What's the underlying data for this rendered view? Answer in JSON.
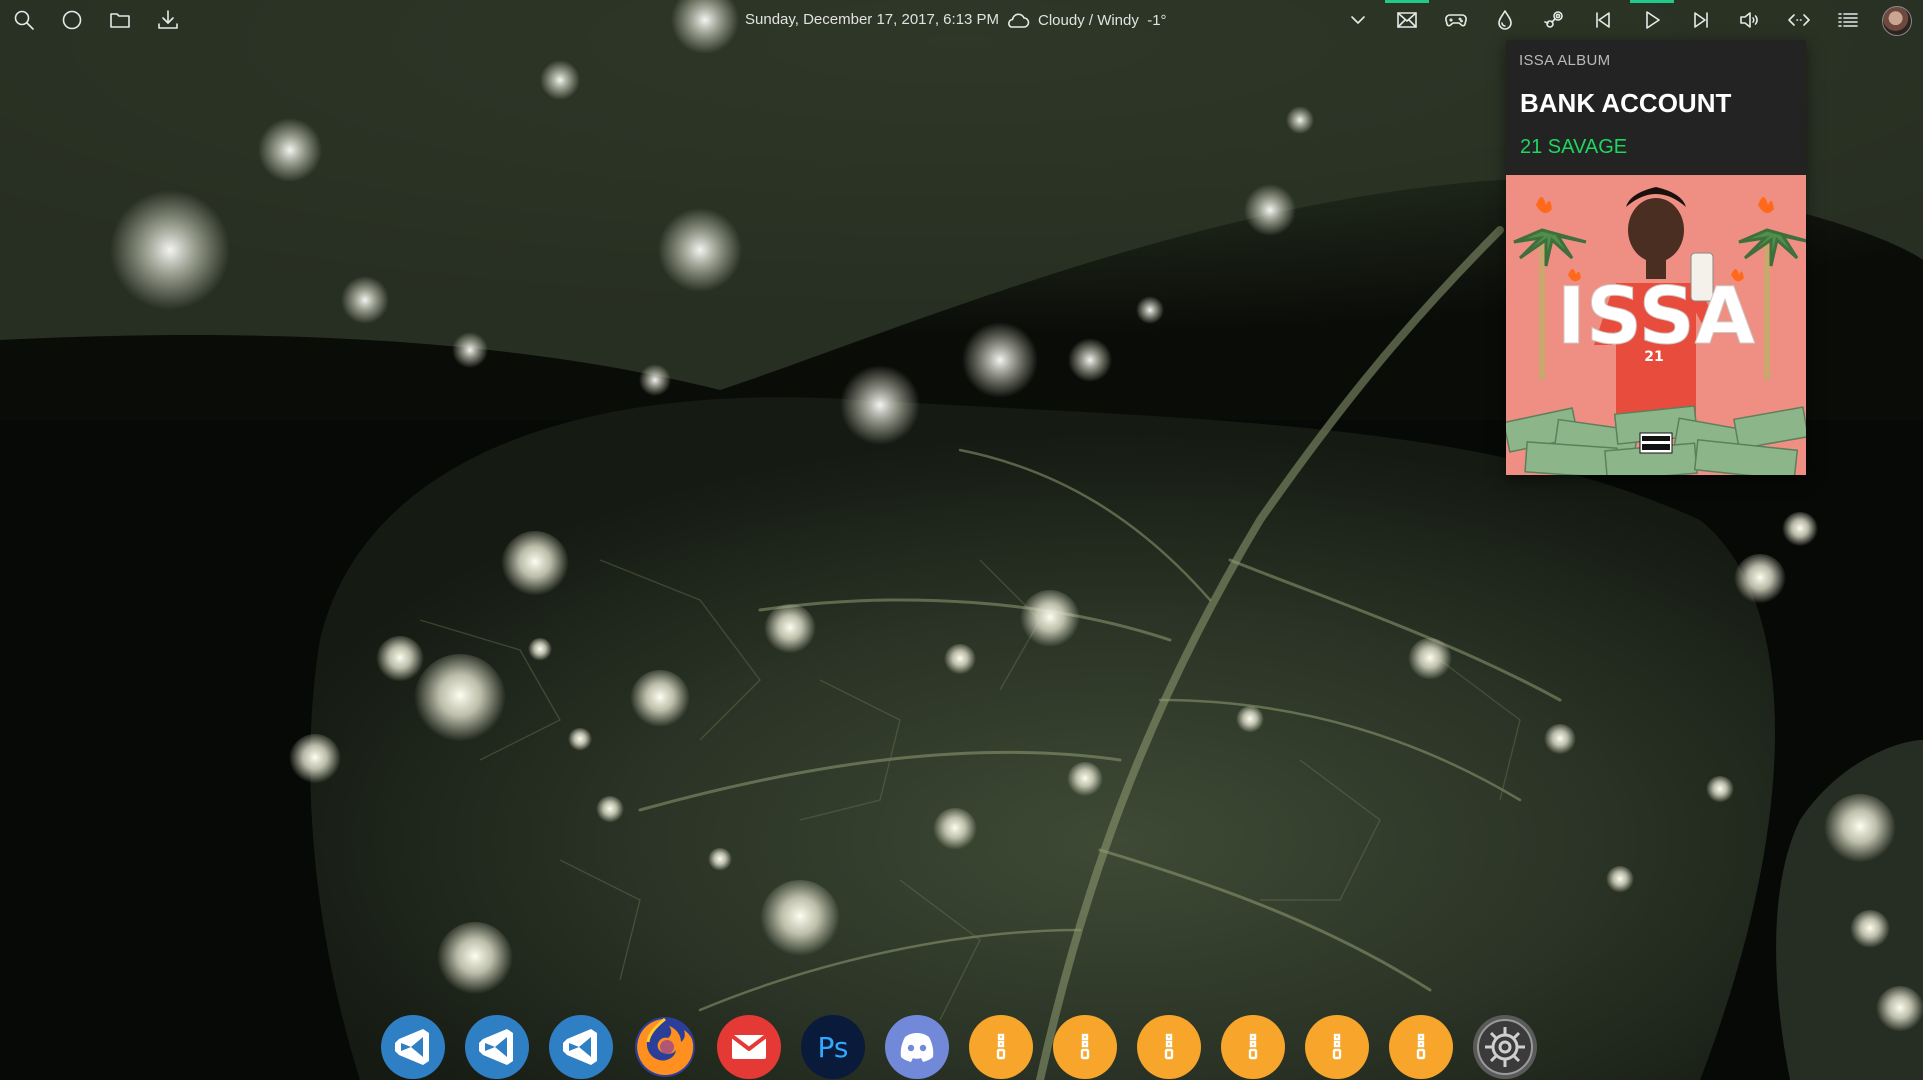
{
  "colors": {
    "accent": "#21c98b",
    "spotify_green": "#1ed760",
    "vs_blue": "#2f7fc4",
    "gmail_red": "#e53935",
    "ps_navy": "#0a1a3a",
    "ps_blue": "#31a8ff",
    "discord": "#7289da",
    "folder_orange": "#f7a52b"
  },
  "topbar": {
    "left_icons": [
      "search-icon",
      "cortana-circle-icon",
      "folder-icon",
      "download-icon"
    ],
    "datetime": "Sunday, December 17, 2017, 6:13 PM",
    "weather_icon": "cloud-icon",
    "weather_text": "Cloudy / Windy  -1°",
    "right_icons": [
      "chevron-down-icon",
      "mail-icon",
      "gamepad-icon",
      "droplet-icon",
      "steam-icon",
      "previous-track-icon",
      "play-icon",
      "next-track-icon",
      "volume-icon",
      "code-icon",
      "list-icon",
      "user-avatar-icon"
    ]
  },
  "music": {
    "album_label": "ISSA ALBUM",
    "track_title": "BANK ACCOUNT",
    "artist": "21 SAVAGE",
    "art_text": "ISSA",
    "art_logo": "21"
  },
  "dock": {
    "apps": [
      {
        "name": "visual-studio-1",
        "icon": "visual-studio-icon"
      },
      {
        "name": "visual-studio-2",
        "icon": "visual-studio-icon"
      },
      {
        "name": "visual-studio-3",
        "icon": "visual-studio-icon"
      },
      {
        "name": "firefox",
        "icon": "firefox-icon"
      },
      {
        "name": "gmail",
        "icon": "gmail-icon"
      },
      {
        "name": "photoshop",
        "icon": "photoshop-icon",
        "label": "Ps"
      },
      {
        "name": "discord",
        "icon": "discord-icon"
      },
      {
        "name": "folder-1",
        "icon": "folder-zip-icon"
      },
      {
        "name": "folder-2",
        "icon": "folder-zip-icon"
      },
      {
        "name": "folder-3",
        "icon": "folder-zip-icon"
      },
      {
        "name": "folder-4",
        "icon": "folder-zip-icon"
      },
      {
        "name": "folder-5",
        "icon": "folder-zip-icon"
      },
      {
        "name": "folder-6",
        "icon": "folder-zip-icon"
      },
      {
        "name": "settings",
        "icon": "settings-gear-icon"
      }
    ]
  }
}
